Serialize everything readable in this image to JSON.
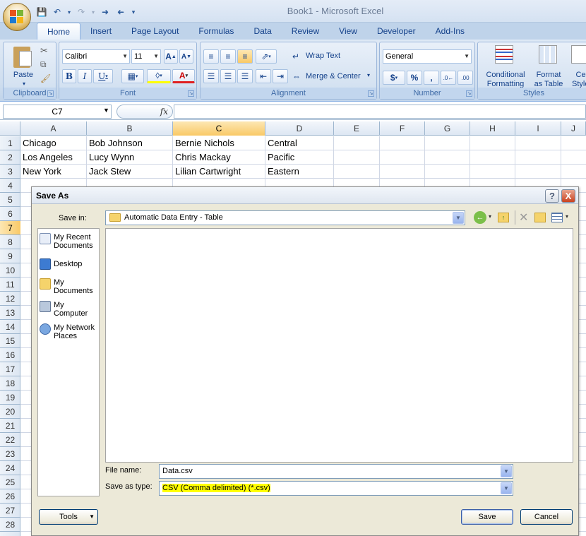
{
  "window": {
    "title": "Book1 - Microsoft Excel"
  },
  "ribbon": {
    "tabs": [
      "Home",
      "Insert",
      "Page Layout",
      "Formulas",
      "Data",
      "Review",
      "View",
      "Developer",
      "Add-Ins"
    ],
    "active_tab": "Home",
    "clipboard": {
      "label": "Clipboard",
      "paste": "Paste"
    },
    "font": {
      "label": "Font",
      "name": "Calibri",
      "size": "11"
    },
    "alignment": {
      "label": "Alignment",
      "wrap_text": "Wrap Text",
      "merge_center": "Merge & Center"
    },
    "number": {
      "label": "Number",
      "format": "General"
    },
    "styles": {
      "label": "Styles",
      "conditional_formatting": "Conditional Formatting",
      "format_as_table": "Format as Table",
      "cell_styles": "Cell Styles"
    }
  },
  "formula_bar": {
    "name_box": "C7",
    "fx": "fx"
  },
  "sheet": {
    "columns": [
      "A",
      "B",
      "C",
      "D",
      "E",
      "F",
      "G",
      "H",
      "I",
      "J"
    ],
    "selected_column": "C",
    "rows": [
      "1",
      "2",
      "3",
      "4",
      "5",
      "6",
      "7",
      "8",
      "9",
      "10",
      "11",
      "12",
      "13",
      "14",
      "15",
      "16",
      "17",
      "18",
      "19",
      "20",
      "21",
      "22",
      "23",
      "24",
      "25",
      "26",
      "27",
      "28"
    ],
    "selected_row": "7",
    "cells": [
      [
        "Chicago",
        "Bob Johnson",
        "Bernie Nichols",
        "Central"
      ],
      [
        "Los Angeles",
        "Lucy Wynn",
        "Chris Mackay",
        "Pacific"
      ],
      [
        "New York",
        "Jack Stew",
        "Lilian Cartwright",
        "Eastern"
      ]
    ]
  },
  "dialog": {
    "title": "Save As",
    "help": "?",
    "close": "X",
    "save_in_label": "Save in:",
    "save_in_value": "Automatic Data Entry - Table",
    "places": [
      "My Recent Documents",
      "Desktop",
      "My Documents",
      "My Computer",
      "My Network Places"
    ],
    "file_name_label": "File name:",
    "file_name_value": "Data.csv",
    "save_as_type_label": "Save as type:",
    "save_as_type_value": "CSV (Comma delimited) (*.csv)",
    "tools": "Tools",
    "save": "Save",
    "cancel": "Cancel"
  },
  "colors": {
    "highlight": "#ffff00",
    "selection": "#f9c967",
    "accent": "#15428b"
  }
}
